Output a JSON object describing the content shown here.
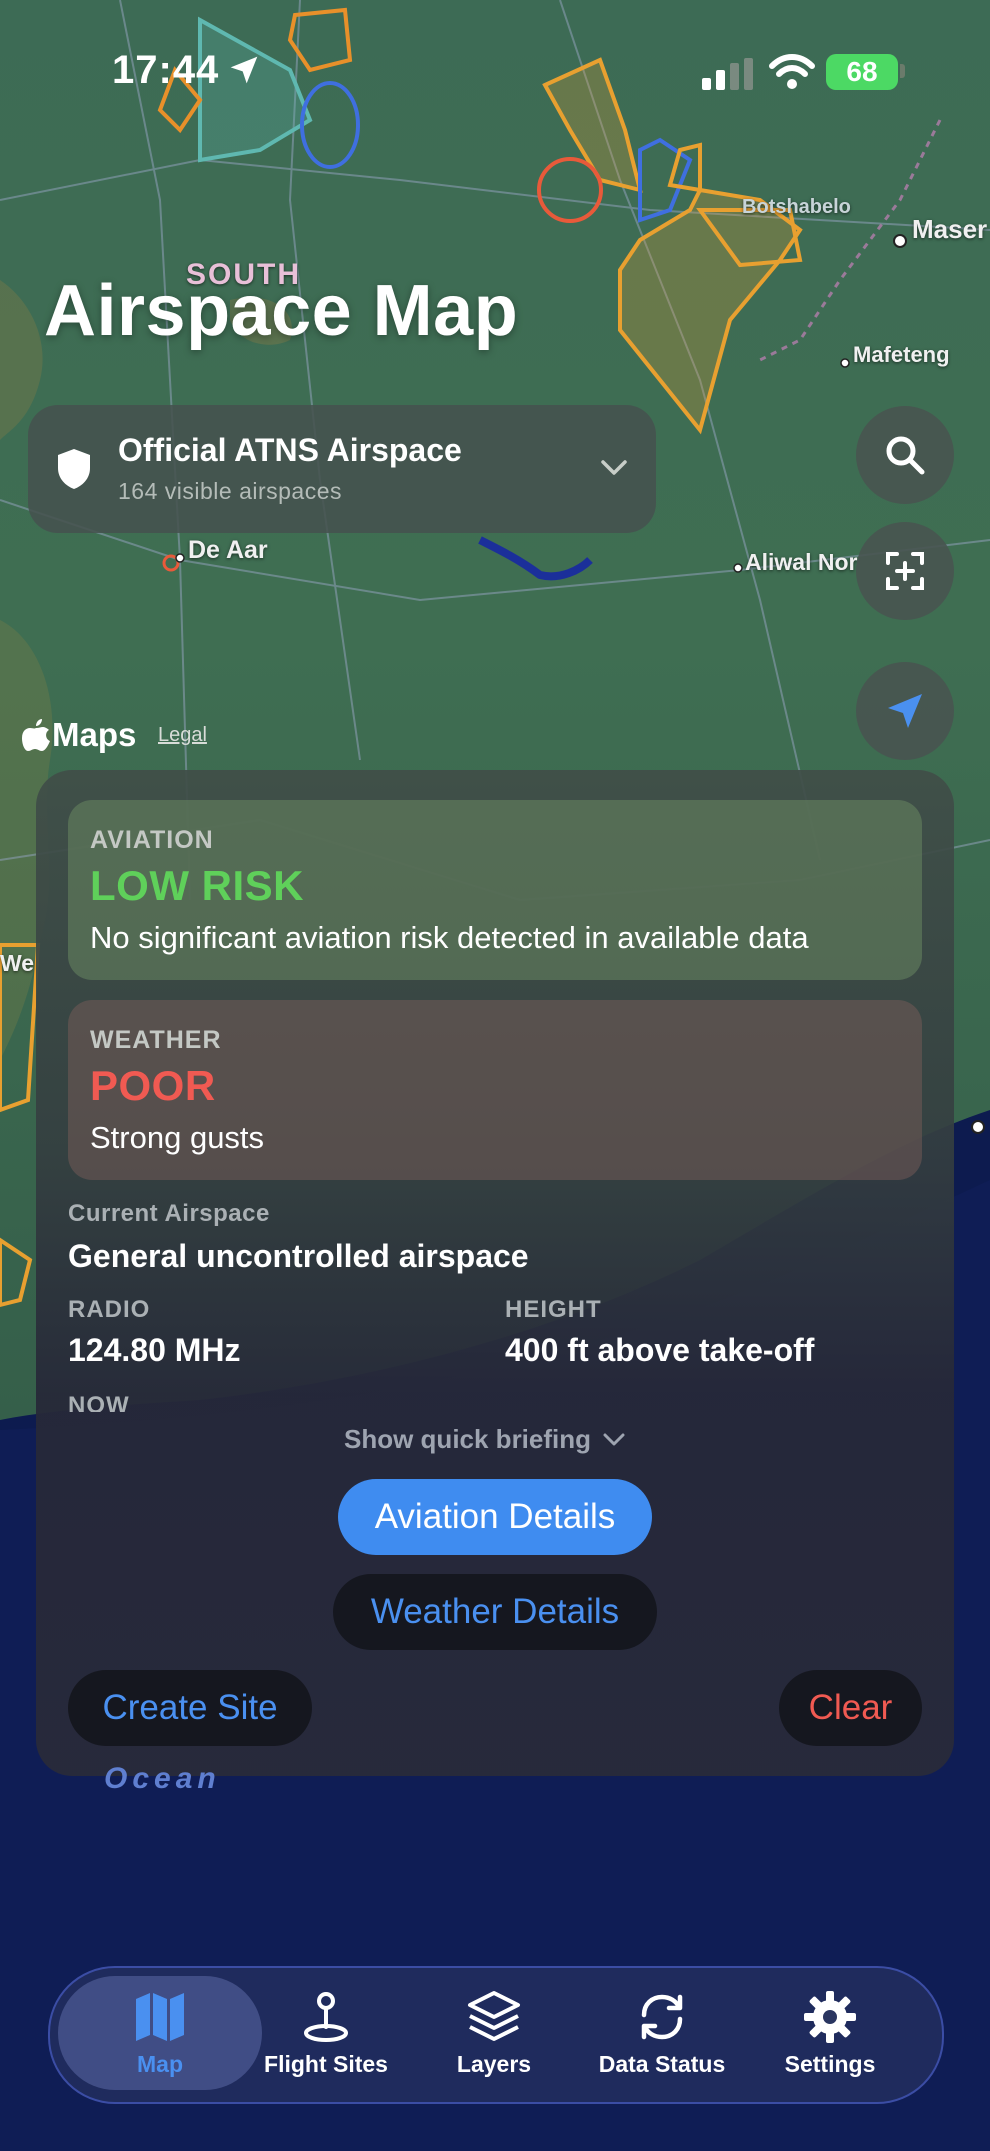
{
  "status_bar": {
    "time": "17:44",
    "battery": "68"
  },
  "page": {
    "title": "Airspace Map"
  },
  "map_labels": {
    "south": "SOUTH",
    "botshabelo": "Botshabelo",
    "maseru": "Maser",
    "mafeteng": "Mafeteng",
    "de_aar": "De Aar",
    "aliwal_north": "Aliwal Nor",
    "west": "We",
    "ocean": "Ocean"
  },
  "airspace_selector": {
    "title": "Official ATNS Airspace",
    "subtitle": "164 visible airspaces"
  },
  "maps_attribution": {
    "logo": "Maps",
    "legal": "Legal"
  },
  "aviation_card": {
    "label": "AVIATION",
    "status": "LOW RISK",
    "description": "No significant aviation risk detected in available data",
    "status_color": "#5fd05a"
  },
  "weather_card": {
    "label": "WEATHER",
    "status": "POOR",
    "description": "Strong gusts",
    "status_color": "#f05a52"
  },
  "details": {
    "current_airspace_label": "Current Airspace",
    "current_airspace_value": "General uncontrolled airspace",
    "radio_label": "RADIO",
    "radio_value": "124.80 MHz",
    "height_label": "HEIGHT",
    "height_value": "400 ft above take-off",
    "now_label": "NOW"
  },
  "actions": {
    "quick_briefing": "Show quick briefing",
    "aviation_details": "Aviation Details",
    "weather_details": "Weather Details",
    "create_site": "Create Site",
    "clear": "Clear"
  },
  "tabs": [
    {
      "label": "Map",
      "icon": "map-icon",
      "active": true
    },
    {
      "label": "Flight Sites",
      "icon": "pin-icon",
      "active": false
    },
    {
      "label": "Layers",
      "icon": "layers-icon",
      "active": false
    },
    {
      "label": "Data Status",
      "icon": "sync-icon",
      "active": false
    },
    {
      "label": "Settings",
      "icon": "gear-icon",
      "active": false
    }
  ],
  "colors": {
    "accent": "#3f8cf0",
    "active_tab": "#4a90f0",
    "danger": "#f05a52",
    "success": "#5fd05a"
  }
}
